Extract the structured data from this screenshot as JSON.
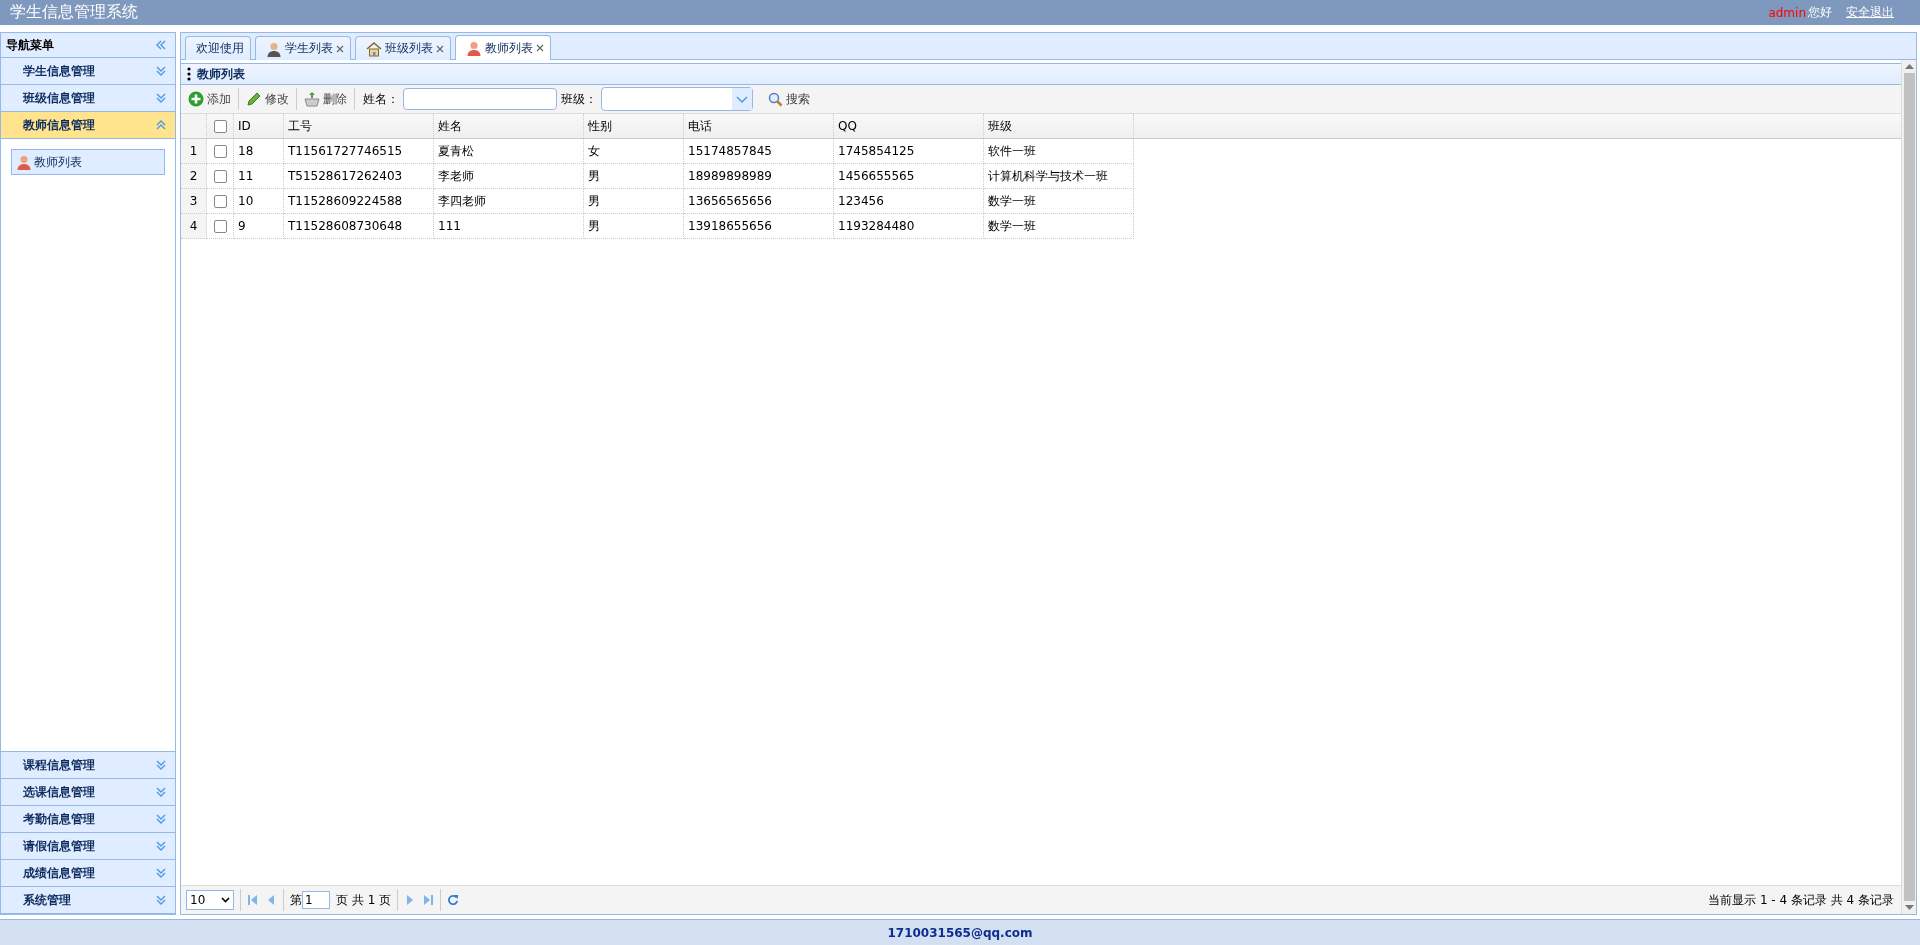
{
  "header": {
    "title": "学生信息管理系统",
    "user": "admin",
    "greeting": "您好",
    "logout": "安全退出"
  },
  "sidebar": {
    "title": "导航菜单",
    "sections": [
      {
        "label": "学生信息管理",
        "expanded": false
      },
      {
        "label": "班级信息管理",
        "expanded": false
      },
      {
        "label": "教师信息管理",
        "expanded": true,
        "children": [
          {
            "label": "教师列表",
            "selected": true
          }
        ]
      },
      {
        "label": "课程信息管理",
        "expanded": false
      },
      {
        "label": "选课信息管理",
        "expanded": false
      },
      {
        "label": "考勤信息管理",
        "expanded": false
      },
      {
        "label": "请假信息管理",
        "expanded": false
      },
      {
        "label": "成绩信息管理",
        "expanded": false
      },
      {
        "label": "系统管理",
        "expanded": false
      }
    ]
  },
  "tabs": [
    {
      "label": "欢迎使用",
      "kind": "welcome",
      "closable": false,
      "selected": false
    },
    {
      "label": "学生列表",
      "kind": "student",
      "closable": true,
      "selected": false
    },
    {
      "label": "班级列表",
      "kind": "class",
      "closable": true,
      "selected": false
    },
    {
      "label": "教师列表",
      "kind": "teacher",
      "closable": true,
      "selected": true
    }
  ],
  "panel": {
    "title": "教师列表"
  },
  "toolbar": {
    "buttons": [
      {
        "label": "添加",
        "kind": "add"
      },
      {
        "label": "修改",
        "kind": "edit"
      },
      {
        "label": "删除",
        "kind": "delete"
      }
    ],
    "name_label": "姓名：",
    "class_label": "班级：",
    "search": "搜索"
  },
  "table": {
    "columns": [
      "ID",
      "工号",
      "姓名",
      "性别",
      "电话",
      "QQ",
      "班级"
    ],
    "all_checked": false,
    "rows": [
      {
        "number": "1",
        "checked": false,
        "cells": [
          "18",
          "T11561727746515",
          "夏青松",
          "女",
          "15174857845",
          "1745854125",
          "软件一班"
        ]
      },
      {
        "number": "2",
        "checked": false,
        "cells": [
          "11",
          "T51528617262403",
          "李老师",
          "男",
          "18989898989",
          "1456655565",
          "计算机科学与技术一班"
        ]
      },
      {
        "number": "3",
        "checked": false,
        "cells": [
          "10",
          "T11528609224588",
          "李四老师",
          "男",
          "13656565656",
          "123456",
          "数学一班"
        ]
      },
      {
        "number": "4",
        "checked": false,
        "cells": [
          "9",
          "T11528608730648",
          "111",
          "男",
          "13918655656",
          "1193284480",
          "数学一班"
        ]
      }
    ]
  },
  "pager": {
    "page_size": "10",
    "page_prefix": "第",
    "page": "1",
    "page_suffix": "页 共 1 页",
    "summary": "当前显示 1 - 4 条记录 共 4 条记录"
  },
  "footer": {
    "email": "1710031565@qq.com"
  }
}
